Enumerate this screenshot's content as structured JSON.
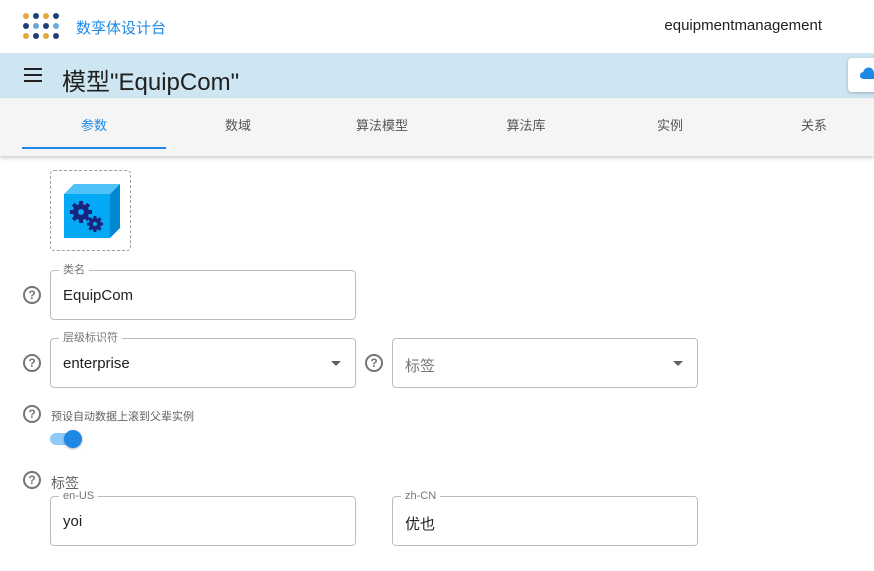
{
  "header": {
    "brand": "数孪体设计台",
    "user": "equipmentmanagement",
    "logo_colors": [
      "#e2a93b",
      "#1e3f7a",
      "#6aa9d8"
    ]
  },
  "titlebar": {
    "title": "模型\"EquipCom\"",
    "background": "#cde6f1"
  },
  "tabs": [
    {
      "label": "参数",
      "active": true
    },
    {
      "label": "数域",
      "active": false
    },
    {
      "label": "算法模型",
      "active": false
    },
    {
      "label": "算法库",
      "active": false
    },
    {
      "label": "实例",
      "active": false
    },
    {
      "label": "关系",
      "active": false
    }
  ],
  "form": {
    "class_name": {
      "legend": "类名",
      "value": "EquipCom"
    },
    "hierarchy": {
      "legend": "层级标识符",
      "value": "enterprise"
    },
    "tags_select": {
      "placeholder": "标签"
    },
    "auto_rollup": {
      "label": "预设自动数据上滚到父辈实例",
      "enabled": true
    },
    "tags_section": {
      "title": "标签"
    },
    "tag_en": {
      "legend": "en-US",
      "value": "yoi"
    },
    "tag_zh": {
      "legend": "zh-CN",
      "value": "优也"
    }
  },
  "icons": {
    "menu": "hamburger-icon",
    "cloud": "cloud-upload-icon",
    "help": "help-circle-icon",
    "model": "gear-cube-icon",
    "dropdown": "caret-down-icon"
  },
  "colors": {
    "accent": "#1e88e5",
    "switch_track": "#90caf9"
  }
}
